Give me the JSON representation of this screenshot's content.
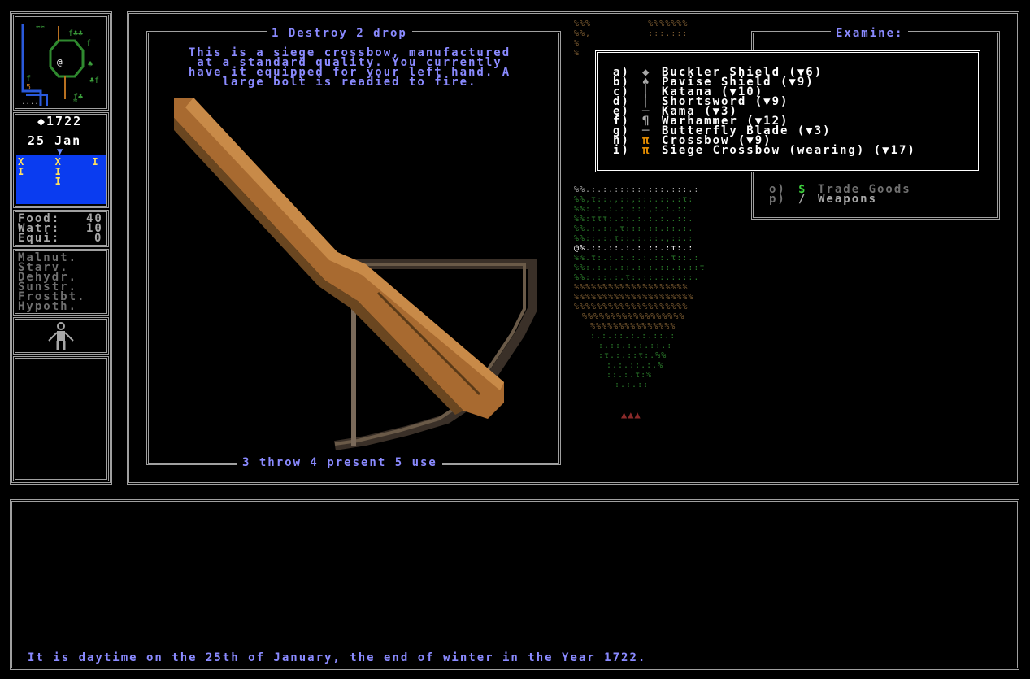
{
  "sidebar": {
    "year": "◆1722",
    "date": "25 Jan",
    "date_marker": "▼",
    "calendar_marks": [
      {
        "row": "X  X  I",
        "color": "#ffe060"
      },
      {
        "row": "I  I",
        "color": "#ffe060"
      },
      {
        "row": "   I",
        "color": "#ffe060"
      }
    ],
    "stats": [
      {
        "label": "Food:",
        "value": "40"
      },
      {
        "label": "Watr:",
        "value": "10"
      },
      {
        "label": "Equi:",
        "value": "0"
      }
    ],
    "conditions": [
      "Malnut.",
      "Starv.",
      "Dehydr.",
      "Sunstr.",
      "Frostbt.",
      "Hypoth."
    ]
  },
  "item_panel": {
    "top_actions": "1 Destroy 2 drop",
    "description": [
      "This is a siege crossbow, manufactured",
      "at a standard quality. You currently",
      "have it equipped for your left hand. A",
      "large bolt is readied to fire."
    ],
    "bottom_actions": "3 throw 4 present 5 use",
    "item_image": "siege-crossbow"
  },
  "examine": {
    "title": "Examine:",
    "items": [
      {
        "key": "a)",
        "icon": "◆",
        "icon_color": "#a8a8a8",
        "label": "Buckler Shield (▼6)"
      },
      {
        "key": "b)",
        "icon": "♠",
        "icon_color": "#a8a8a8",
        "label": "Pavise Shield (▼9)"
      },
      {
        "key": "c)",
        "icon": "│",
        "icon_color": "#a8a8a8",
        "label": "Katana (▼10)"
      },
      {
        "key": "d)",
        "icon": "│",
        "icon_color": "#a8a8a8",
        "label": "Shortsword (▼9)"
      },
      {
        "key": "e)",
        "icon": "─",
        "icon_color": "#a8a8a8",
        "label": "Kama (▼3)"
      },
      {
        "key": "f)",
        "icon": "¶",
        "icon_color": "#a8a8a8",
        "label": "Warhammer (▼12)"
      },
      {
        "key": "g)",
        "icon": "─",
        "icon_color": "#a8a8a8",
        "label": "Butterfly Blade (▼3)"
      },
      {
        "key": "h)",
        "icon": "π",
        "icon_color": "#e08a00",
        "label": "Crossbow (▼9)"
      },
      {
        "key": "i)",
        "icon": "π",
        "icon_color": "#e08a00",
        "label": "Siege Crossbow (wearing) (▼17)"
      }
    ],
    "categories": [
      {
        "key": "o)",
        "icon": "$",
        "icon_color": "#3cd03c",
        "label": "Trade Goods"
      },
      {
        "key": "p)",
        "icon": "/",
        "icon_color": "#a8a8a8",
        "label": "Weapons"
      }
    ]
  },
  "message_log": {
    "message": "It is daytime on the 25th of January, the end of winter in the Year 1722."
  }
}
